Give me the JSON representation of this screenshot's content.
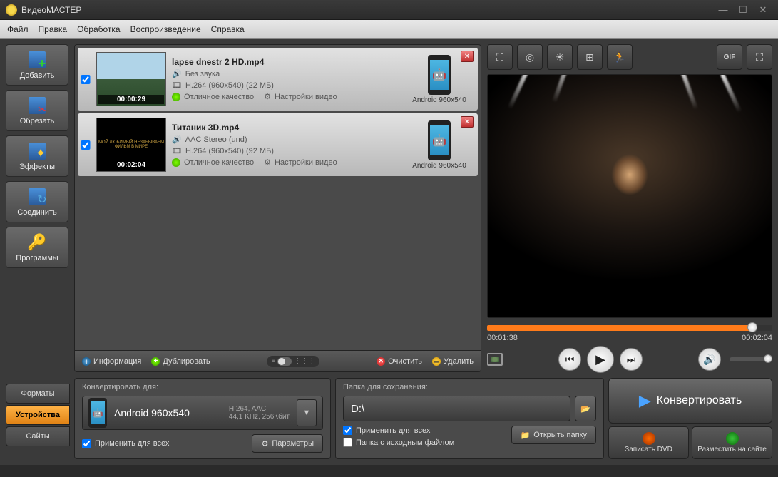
{
  "app": {
    "title": "ВидеоМАСТЕР"
  },
  "menubar": [
    "Файл",
    "Правка",
    "Обработка",
    "Воспроизведение",
    "Справка"
  ],
  "sidebar": [
    {
      "label": "Добавить",
      "icon": "add"
    },
    {
      "label": "Обрезать",
      "icon": "cut"
    },
    {
      "label": "Эффекты",
      "icon": "fx"
    },
    {
      "label": "Соединить",
      "icon": "join"
    },
    {
      "label": "Программы",
      "icon": "apps"
    }
  ],
  "items": [
    {
      "title": "lapse dnestr 2 HD.mp4",
      "duration": "00:00:29",
      "audio": "Без звука",
      "video": "H.264 (960x540) (22 МБ)",
      "quality": "Отличное качество",
      "settings": "Настройки видео",
      "device": "Android 960x540",
      "checked": true
    },
    {
      "title": "Титаник 3D.mp4",
      "duration": "00:02:04",
      "audio": "AAC Stereo (und)",
      "video": "H.264 (960x540) (92 МБ)",
      "quality": "Отличное качество",
      "settings": "Настройки видео",
      "device": "Android 960x540",
      "checked": true
    }
  ],
  "list_toolbar": {
    "info": "Информация",
    "dup": "Дублировать",
    "clear": "Очистить",
    "del": "Удалить"
  },
  "preview": {
    "time_current": "00:01:38",
    "time_total": "00:02:04",
    "gif_label": "GIF"
  },
  "bottom": {
    "tabs": [
      "Форматы",
      "Устройства",
      "Сайты"
    ],
    "active_tab": 1,
    "convert_for_label": "Конвертировать для:",
    "profile_name": "Android 960x540",
    "profile_line1": "H.264, AAC",
    "profile_line2": "44,1 KHz, 256Кбит",
    "apply_all": "Применить для всех",
    "params": "Параметры",
    "save_folder_label": "Папка для сохранения:",
    "folder": "D:\\",
    "source_folder": "Папка с исходным файлом",
    "open_folder": "Открыть папку",
    "convert": "Конвертировать",
    "burn_dvd": "Записать DVD",
    "upload": "Разместить на сайте"
  }
}
